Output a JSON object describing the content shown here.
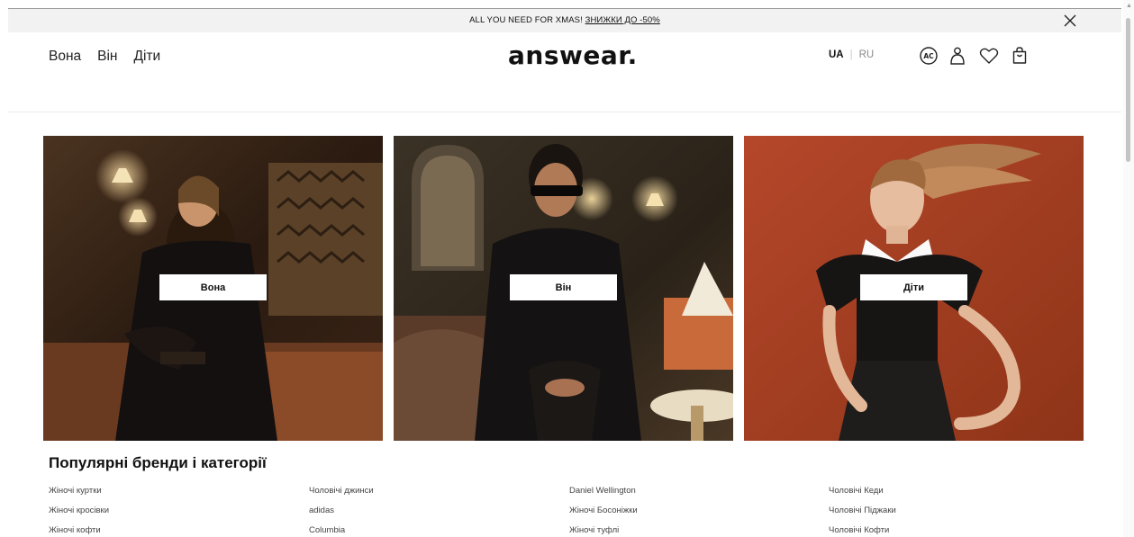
{
  "promo": {
    "text": "ALL YOU NEED FOR XMAS! ",
    "link_label": "ЗНИЖКИ ДО -50%"
  },
  "header": {
    "nav": [
      "Вона",
      "Він",
      "Діти"
    ],
    "logo": "answear.",
    "lang_active": "UA",
    "lang_other": "RU",
    "icons": [
      "ac-club-icon",
      "user-icon",
      "heart-icon",
      "shopping-bag-icon"
    ]
  },
  "heroes": [
    {
      "label": "Вона"
    },
    {
      "label": "Він"
    },
    {
      "label": "Діти"
    }
  ],
  "popular": {
    "title": "Популярні бренди і категорії",
    "columns": [
      [
        "Жіночі куртки",
        "Жіночі кросівки",
        "Жіночі кофти"
      ],
      [
        "Чоловічі джинси",
        "adidas",
        "Columbia"
      ],
      [
        "Daniel Wellington",
        "Жіночі Босоніжки",
        "Жіночі туфлі"
      ],
      [
        "Чоловічі Кеди",
        "Чоловічі Піджаки",
        "Чоловічі Кофти"
      ]
    ]
  },
  "colors": {
    "promo_bg": "#f2f2f2",
    "hero_she_bg": "#3a2418",
    "hero_he_bg": "#2c2419",
    "hero_kids_bg": "#a23c1e"
  }
}
